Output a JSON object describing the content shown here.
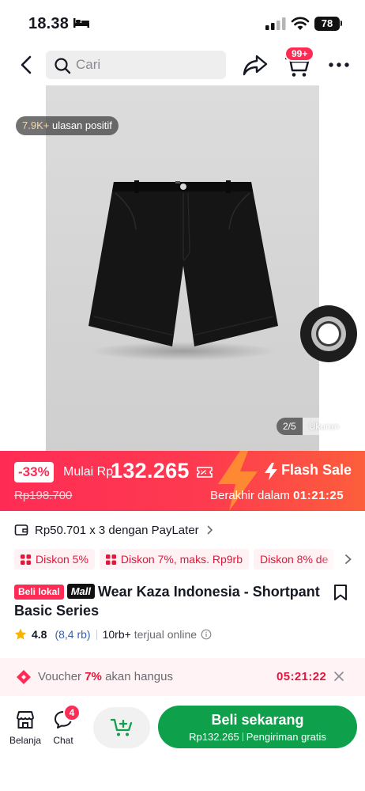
{
  "status_bar": {
    "time": "18.38",
    "battery": "78"
  },
  "header": {
    "search_placeholder": "Cari",
    "cart_badge": "99+"
  },
  "gallery": {
    "review_count": "7.9K+",
    "review_label": "ulasan positif",
    "page_index": "2/5",
    "size_label": "Ukuran"
  },
  "flash": {
    "discount": "-33%",
    "price_prefix": "Mulai Rp",
    "price": "132.265",
    "original_price": "Rp198.700",
    "label": "Flash Sale",
    "ends_prefix": "Berakhir dalam",
    "countdown": "01:21:25"
  },
  "paylater": {
    "text": "Rp50.701 x 3 dengan PayLater"
  },
  "discount_chips": [
    {
      "label": "Diskon 5%"
    },
    {
      "label": "Diskon 7%, maks. Rp9rb"
    },
    {
      "label": "Diskon 8% de"
    }
  ],
  "product": {
    "tag_local": "Beli lokal",
    "tag_mall": "Mall",
    "title": "Wear Kaza Indonesia - Shortpant Basic Series",
    "rating": "4.8",
    "rating_count": "(8,4 rb)",
    "sold_count": "10rb+",
    "sold_label": "terjual online"
  },
  "voucher": {
    "prefix": "Voucher",
    "percent": "7%",
    "suffix": "akan hangus",
    "countdown": "05:21:22"
  },
  "bottom_bar": {
    "shop_label": "Belanja",
    "chat_label": "Chat",
    "chat_badge": "4",
    "buy_label": "Beli sekarang",
    "buy_price": "Rp132.265",
    "buy_shipping": "Pengiriman gratis"
  },
  "colors": {
    "accent": "#fe2c55",
    "buy_green": "#0fa04b",
    "rating_link": "#3862a8"
  }
}
